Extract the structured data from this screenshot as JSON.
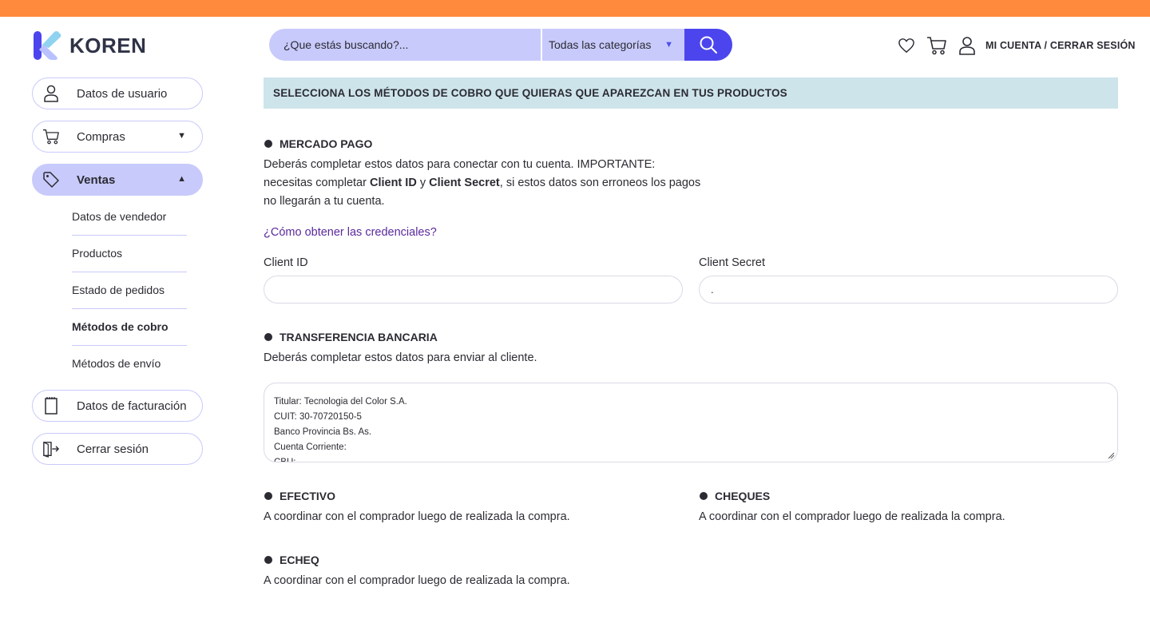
{
  "brand": {
    "name": "KOREN",
    "accent_top": "#ff8a3d",
    "accent_primary": "#4c45ee",
    "accent_soft": "#c8cafb",
    "banner_bg": "#cde4ea"
  },
  "search": {
    "placeholder": "¿Que estás buscando?...",
    "category": "Todas las categorías"
  },
  "header": {
    "account_label": "MI CUENTA / CERRAR SESIÓN",
    "icons": [
      "heart-icon",
      "cart-icon",
      "user-icon"
    ]
  },
  "sidebar": {
    "user_data": "Datos de usuario",
    "purchases": "Compras",
    "sales": "Ventas",
    "sales_items": [
      "Datos de vendedor",
      "Productos",
      "Estado de pedidos",
      "Métodos de cobro",
      "Métodos de envío"
    ],
    "billing": "Datos de facturación",
    "logout": "Cerrar sesión"
  },
  "main": {
    "banner": "SELECCIONA LOS MÉTODOS DE COBRO QUE QUIERAS QUE APAREZCAN EN TUS PRODUCTOS",
    "mercado_pago": {
      "title": "MERCADO PAGO",
      "line1": "Deberás completar estos datos para conectar con tu cuenta. IMPORTANTE:",
      "line2_a": "necesitas completar ",
      "line2_b": "Client ID",
      "line2_c": " y ",
      "line2_d": "Client Secret",
      "line2_e": ", si estos datos son erroneos los pagos",
      "line3": "no llegarán a tu cuenta.",
      "link": "¿Cómo obtener las credenciales?",
      "client_id_label": "Client ID",
      "client_id_value": "",
      "client_secret_label": "Client Secret",
      "client_secret_value": "."
    },
    "transferencia": {
      "title": "TRANSFERENCIA BANCARIA",
      "desc": "Deberás completar estos datos para enviar al cliente.",
      "lines": [
        "Titular: Tecnologia del Color S.A.",
        "CUIT: 30-70720150-5",
        "Banco Provincia Bs. As.",
        "Cuenta Corriente:",
        "CBU:"
      ]
    },
    "efectivo": {
      "title": "EFECTIVO",
      "desc": "A coordinar con el comprador luego de realizada la compra."
    },
    "cheques": {
      "title": "CHEQUES",
      "desc": "A coordinar con el comprador luego de realizada la compra."
    },
    "echeq": {
      "title": "ECHEQ",
      "desc": "A coordinar con el comprador luego de realizada la compra."
    }
  }
}
